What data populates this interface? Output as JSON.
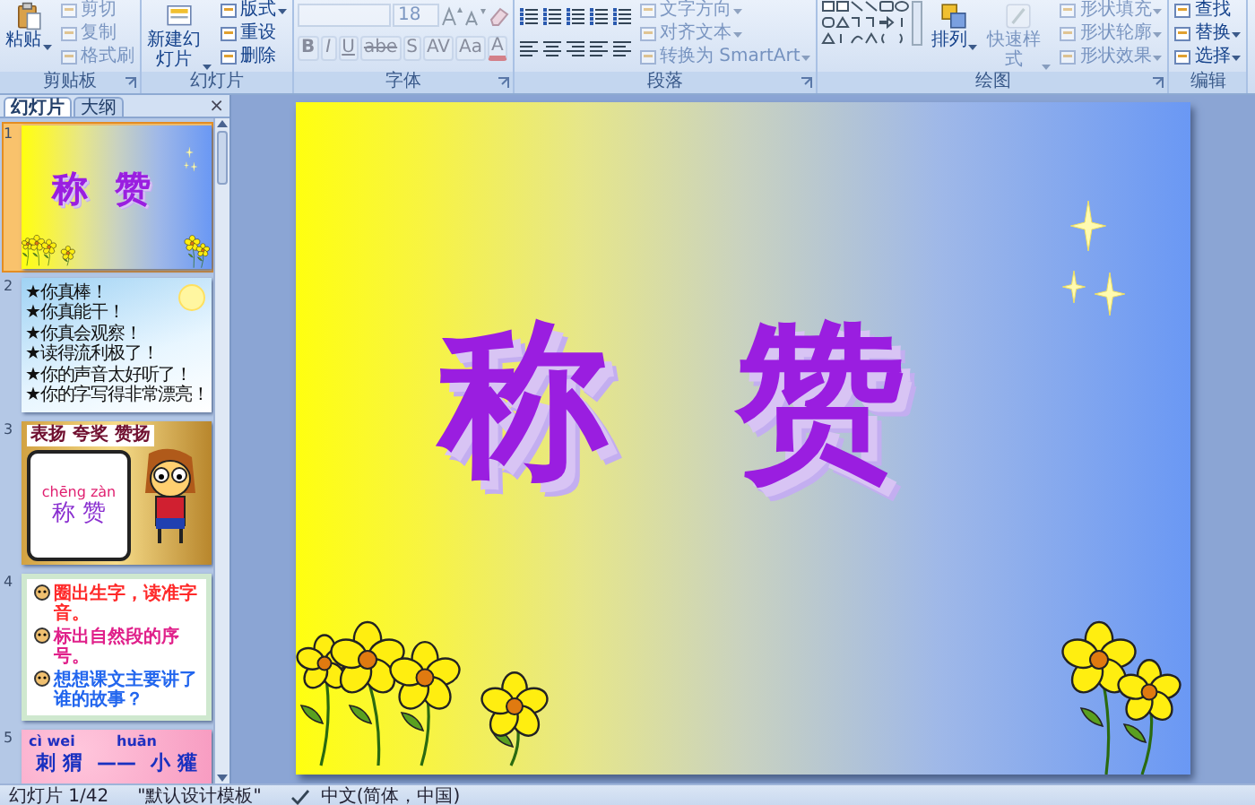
{
  "ribbon": {
    "groups": [
      {
        "label": "剪贴板",
        "launcher": true,
        "columns": [
          {
            "items": [
              {
                "kind": "big",
                "label": "粘贴",
                "menu": true,
                "disabled": false
              }
            ]
          },
          {
            "items": [
              {
                "kind": "small",
                "label": "剪切",
                "menu": false,
                "disabled": true
              },
              {
                "kind": "small",
                "label": "复制",
                "menu": false,
                "disabled": true
              },
              {
                "kind": "small",
                "label": "格式刷",
                "menu": false,
                "disabled": true
              }
            ]
          }
        ]
      },
      {
        "label": "幻灯片",
        "launcher": false,
        "columns": [
          {
            "items": [
              {
                "kind": "big",
                "label": "新建幻灯片",
                "menu": true,
                "disabled": false
              }
            ]
          },
          {
            "items": [
              {
                "kind": "small",
                "label": "版式",
                "menu": true,
                "disabled": false
              },
              {
                "kind": "small",
                "label": "重设",
                "menu": false,
                "disabled": false
              },
              {
                "kind": "small",
                "label": "删除",
                "menu": false,
                "disabled": false
              }
            ]
          }
        ]
      },
      {
        "label": "字体",
        "launcher": true,
        "columns": [
          {
            "items": [
              {
                "kind": "fontbar",
                "size": "18",
                "disabled": true
              },
              {
                "kind": "toolrow",
                "buttons": [
                  "B",
                  "I",
                  "U",
                  "abe",
                  "S",
                  "AV",
                  "Aa",
                  "A"
                ],
                "disabled": true
              }
            ]
          }
        ]
      },
      {
        "label": "段落",
        "launcher": true,
        "columns": [
          {
            "items": [
              {
                "kind": "listbar",
                "disabled": false
              },
              {
                "kind": "alignbar",
                "disabled": false
              }
            ]
          },
          {
            "items": [
              {
                "kind": "small",
                "label": "文字方向",
                "menu": true,
                "disabled": true
              },
              {
                "kind": "small",
                "label": "对齐文本",
                "menu": true,
                "disabled": true
              },
              {
                "kind": "small",
                "label": "转换为 SmartArt",
                "menu": true,
                "disabled": true
              }
            ]
          }
        ]
      },
      {
        "label": "绘图",
        "launcher": true,
        "columns": [
          {
            "items": [
              {
                "kind": "shapes",
                "disabled": false
              }
            ]
          },
          {
            "items": [
              {
                "kind": "big",
                "label": "排列",
                "menu": true,
                "disabled": false
              }
            ]
          },
          {
            "items": [
              {
                "kind": "big",
                "label": "快速样式",
                "menu": true,
                "disabled": true
              }
            ]
          },
          {
            "items": [
              {
                "kind": "small",
                "label": "形状填充",
                "menu": true,
                "disabled": true
              },
              {
                "kind": "small",
                "label": "形状轮廓",
                "menu": true,
                "disabled": true
              },
              {
                "kind": "small",
                "label": "形状效果",
                "menu": true,
                "disabled": true
              }
            ]
          }
        ]
      },
      {
        "label": "编辑",
        "launcher": false,
        "columns": [
          {
            "items": [
              {
                "kind": "small",
                "label": "查找",
                "menu": false,
                "disabled": false
              },
              {
                "kind": "small",
                "label": "替换",
                "menu": true,
                "disabled": false
              },
              {
                "kind": "small",
                "label": "选择",
                "menu": true,
                "disabled": false
              }
            ]
          }
        ]
      }
    ]
  },
  "pane": {
    "tabs": [
      {
        "label": "幻灯片",
        "selected": true
      },
      {
        "label": "大纲",
        "selected": false
      }
    ],
    "close": "×",
    "slides": [
      {
        "number": "1",
        "selected": true,
        "kind": "title",
        "title": [
          "称",
          "赞"
        ]
      },
      {
        "number": "2",
        "selected": false,
        "kind": "list",
        "lines": [
          "★你真棒！",
          "★你真能干！",
          "★你真会观察！",
          "★读得流利极了！",
          "★你的声音太好听了！",
          "★你的字写得非常漂亮！"
        ]
      },
      {
        "number": "3",
        "selected": false,
        "kind": "bubble",
        "header": "表扬 夸奖 赞扬",
        "pinyin": "chēng zàn",
        "word": "称 赞"
      },
      {
        "number": "4",
        "selected": false,
        "kind": "tasks",
        "lines": [
          {
            "text": "圈出生字，读准字音。",
            "color": "#ff2a2a"
          },
          {
            "text": "标出自然段的序号。",
            "color": "#e0208a"
          },
          {
            "text": "想想课文主要讲了谁的故事？",
            "color": "#2266ee"
          }
        ]
      },
      {
        "number": "5",
        "selected": false,
        "kind": "pinyin",
        "pinyin": [
          "cì wei",
          "huān"
        ],
        "words": [
          "刺 猬",
          "——",
          "小 獾"
        ]
      }
    ]
  },
  "slide": {
    "title": [
      "称",
      "赞"
    ]
  },
  "status_bar": {
    "slide": "幻灯片 1/42",
    "theme": "\"默认设计模板\"",
    "language": "中文(简体，中国)"
  }
}
